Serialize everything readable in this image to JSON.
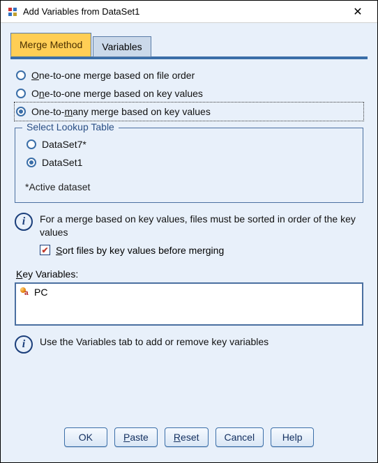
{
  "window": {
    "title": "Add Variables from DataSet1",
    "close_glyph": "✕"
  },
  "tabs": {
    "merge_method": "Merge Method",
    "variables": "Variables"
  },
  "merge_options": {
    "opt1_pre": "O",
    "opt1_post": "ne-to-one merge based on file order",
    "opt2_pre": "O",
    "opt2_post": "e-to-one merge based on key values",
    "opt2_u": "n",
    "opt3_pre": "One-to-",
    "opt3_u": "m",
    "opt3_post": "any merge based on key values"
  },
  "lookup": {
    "legend": "Select Lookup Table",
    "option1": "DataSet7*",
    "option2": "DataSet1",
    "note": "*Active dataset"
  },
  "info1": "For a merge based on key values, files must be sorted in order of the key values",
  "sort_cb_pre": "S",
  "sort_cb_post": "ort files by key values before merging",
  "kv_label_u": "K",
  "kv_label_post": "ey Variables:",
  "kv_items": [
    {
      "name": "PC"
    }
  ],
  "info2": "Use the Variables tab to add or remove key variables",
  "buttons": {
    "ok": "OK",
    "paste_u": "P",
    "paste_post": "aste",
    "reset_u": "R",
    "reset_post": "eset",
    "cancel": "Cancel",
    "help": "Help"
  }
}
